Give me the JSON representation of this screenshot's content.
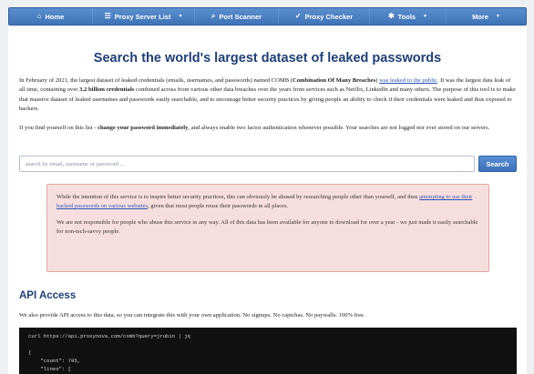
{
  "nav": {
    "items": [
      {
        "label": "Home",
        "icon": "home-icon",
        "glyph": "⌂",
        "dropdown": false
      },
      {
        "label": "Proxy Server List",
        "icon": "list-icon",
        "glyph": "☰",
        "dropdown": true
      },
      {
        "label": "Port Scanner",
        "icon": "search-icon",
        "glyph": "⌕",
        "dropdown": false
      },
      {
        "label": "Proxy Checker",
        "icon": "check-icon",
        "glyph": "✓",
        "dropdown": false
      },
      {
        "label": "Tools",
        "icon": "tools-icon",
        "glyph": "✱",
        "dropdown": true
      },
      {
        "label": "More",
        "icon": "",
        "glyph": "",
        "dropdown": true
      }
    ]
  },
  "main": {
    "title": "Search the world's largest dataset of leaked passwords",
    "intro": {
      "part1": "In February of 2021, the largest dataset of leaked credentials (emails, usernames, and passwords) named COMB (",
      "comb_bold": "Combination Of Many Breaches",
      "part2": ") ",
      "link": "was leaked to the public",
      "part3": ". It was the largest data leak of all time, containing over ",
      "billion_bold": "3.2 billion credentials",
      "part4": " combined across from various other data breaches over the years from services such as Netflix, LinkedIn and many others. The purpose of this tool is to make that massive dataset of leaked usernames and passwords easily searchable, and to encourage better security practices by giving people an ability to check if their credentials were leaked and thus exposed to hackers."
    },
    "advice": {
      "part1": "If you find yourself on this list - ",
      "bold": "change your password immediately",
      "part2": ", and always enable two factor authentication whenever possible. Your searches are not logged nor ever stored on our servers."
    },
    "search": {
      "placeholder": "search by email, username or password ...",
      "button": "Search"
    },
    "warning": {
      "p1_part1": "While the intention of this service is to inspire better security practices, this can obviously be abused by researching people other than yourself, and then ",
      "p1_link": "attempting to use their hacked passwords on various websites",
      "p1_part2": ", given that most people reuse their passwords in all places.",
      "p2": "We are not responsible for people who abuse this service in any way. All of this data has been available for anyone to download for over a year - we just made it easily searchable for non-tech-savvy people."
    },
    "api": {
      "title": "API Access",
      "text": "We also provide API access to this data, so you can integrate this with your own application. No signups. No captchas. No paywalls. 100% free.",
      "code": "curl https://api.proxynova.com/comb?query=jrubin | jq\n\n{\n    \"count\": 795,\n    \"lines\": ["
    }
  }
}
